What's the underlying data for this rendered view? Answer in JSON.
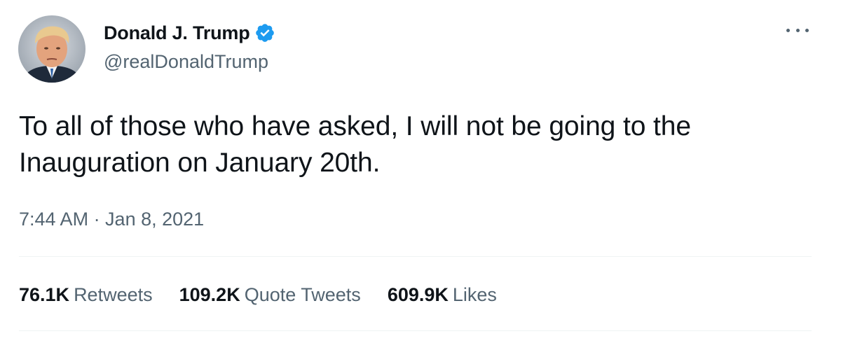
{
  "author": {
    "display_name": "Donald J. Trump",
    "handle": "@realDonaldTrump",
    "verified": true,
    "verified_color": "#1d9bf0",
    "avatar_icon": "profile-photo"
  },
  "tweet": {
    "text": "To all of those who have asked, I will not be going to the Inauguration on January 20th.",
    "timestamp": "7:44 AM · Jan 8, 2021"
  },
  "menu": {
    "icon": "more-horizontal-icon"
  },
  "stats": [
    {
      "value": "76.1K",
      "label": "Retweets"
    },
    {
      "value": "109.2K",
      "label": "Quote Tweets"
    },
    {
      "value": "609.9K",
      "label": "Likes"
    }
  ],
  "colors": {
    "text_primary": "#0f1419",
    "text_secondary": "#536471",
    "divider": "#eff3f4"
  }
}
